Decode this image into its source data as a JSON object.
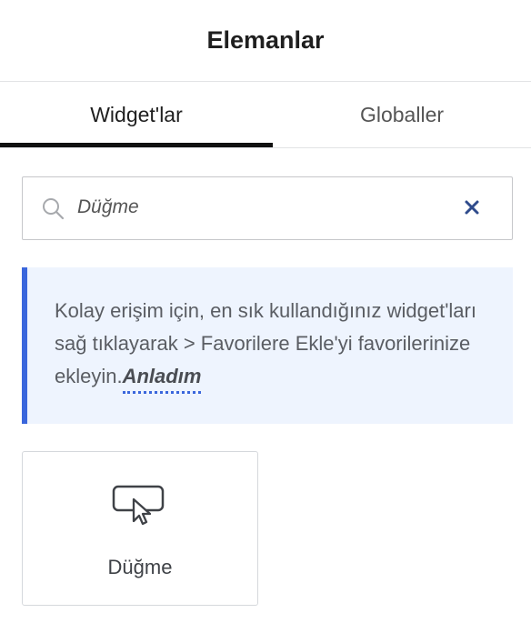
{
  "panel": {
    "title": "Elemanlar"
  },
  "tabs": [
    {
      "label": "Widget'lar",
      "active": true
    },
    {
      "label": "Globaller",
      "active": false
    }
  ],
  "search": {
    "value": "Düğme",
    "icon": "search-icon",
    "clear_icon": "close-icon"
  },
  "notice": {
    "text": "Kolay erişim için, en sık kullandığınız widget'ları sağ tıklayarak > Favorilere Ekle'yi favorilerinize ekleyin.",
    "link_label": "Anladım",
    "accent_color": "#3a66dc",
    "background_color": "#eef4fe"
  },
  "widgets": [
    {
      "label": "Düğme",
      "icon": "button-pointer-icon"
    }
  ]
}
